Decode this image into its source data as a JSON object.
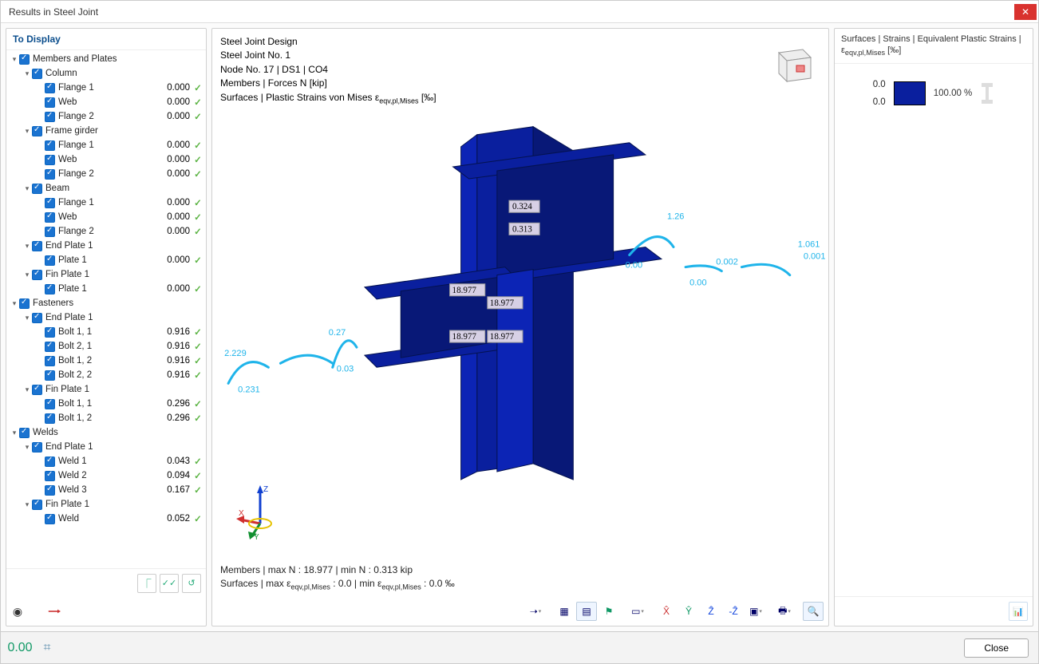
{
  "titlebar": {
    "title": "Results in Steel Joint"
  },
  "left_panel": {
    "header": "To Display"
  },
  "tree": [
    {
      "lvl": 0,
      "caret": "down",
      "cb": true,
      "label": "Members and Plates"
    },
    {
      "lvl": 1,
      "caret": "down",
      "cb": true,
      "label": "Column"
    },
    {
      "lvl": 2,
      "caret": "",
      "cb": true,
      "label": "Flange 1",
      "val": "0.000",
      "ok": true
    },
    {
      "lvl": 2,
      "caret": "",
      "cb": true,
      "label": "Web",
      "val": "0.000",
      "ok": true
    },
    {
      "lvl": 2,
      "caret": "",
      "cb": true,
      "label": "Flange 2",
      "val": "0.000",
      "ok": true
    },
    {
      "lvl": 1,
      "caret": "down",
      "cb": true,
      "label": "Frame girder"
    },
    {
      "lvl": 2,
      "caret": "",
      "cb": true,
      "label": "Flange 1",
      "val": "0.000",
      "ok": true
    },
    {
      "lvl": 2,
      "caret": "",
      "cb": true,
      "label": "Web",
      "val": "0.000",
      "ok": true
    },
    {
      "lvl": 2,
      "caret": "",
      "cb": true,
      "label": "Flange 2",
      "val": "0.000",
      "ok": true
    },
    {
      "lvl": 1,
      "caret": "down",
      "cb": true,
      "label": "Beam"
    },
    {
      "lvl": 2,
      "caret": "",
      "cb": true,
      "label": "Flange 1",
      "val": "0.000",
      "ok": true
    },
    {
      "lvl": 2,
      "caret": "",
      "cb": true,
      "label": "Web",
      "val": "0.000",
      "ok": true
    },
    {
      "lvl": 2,
      "caret": "",
      "cb": true,
      "label": "Flange 2",
      "val": "0.000",
      "ok": true
    },
    {
      "lvl": 1,
      "caret": "down",
      "cb": true,
      "label": "End Plate 1"
    },
    {
      "lvl": 2,
      "caret": "",
      "cb": true,
      "label": "Plate 1",
      "val": "0.000",
      "ok": true
    },
    {
      "lvl": 1,
      "caret": "down",
      "cb": true,
      "label": "Fin Plate 1"
    },
    {
      "lvl": 2,
      "caret": "",
      "cb": true,
      "label": "Plate 1",
      "val": "0.000",
      "ok": true
    },
    {
      "lvl": 0,
      "caret": "down",
      "cb": true,
      "label": "Fasteners"
    },
    {
      "lvl": 1,
      "caret": "down",
      "cb": true,
      "label": "End Plate 1"
    },
    {
      "lvl": 2,
      "caret": "",
      "cb": true,
      "label": "Bolt 1, 1",
      "val": "0.916",
      "ok": true
    },
    {
      "lvl": 2,
      "caret": "",
      "cb": true,
      "label": "Bolt 2, 1",
      "val": "0.916",
      "ok": true
    },
    {
      "lvl": 2,
      "caret": "",
      "cb": true,
      "label": "Bolt 1, 2",
      "val": "0.916",
      "ok": true
    },
    {
      "lvl": 2,
      "caret": "",
      "cb": true,
      "label": "Bolt 2, 2",
      "val": "0.916",
      "ok": true
    },
    {
      "lvl": 1,
      "caret": "down",
      "cb": true,
      "label": "Fin Plate 1"
    },
    {
      "lvl": 2,
      "caret": "",
      "cb": true,
      "label": "Bolt 1, 1",
      "val": "0.296",
      "ok": true
    },
    {
      "lvl": 2,
      "caret": "",
      "cb": true,
      "label": "Bolt 1, 2",
      "val": "0.296",
      "ok": true
    },
    {
      "lvl": 0,
      "caret": "down",
      "cb": true,
      "label": "Welds"
    },
    {
      "lvl": 1,
      "caret": "down",
      "cb": true,
      "label": "End Plate 1"
    },
    {
      "lvl": 2,
      "caret": "",
      "cb": true,
      "label": "Weld 1",
      "val": "0.043",
      "ok": true
    },
    {
      "lvl": 2,
      "caret": "",
      "cb": true,
      "label": "Weld 2",
      "val": "0.094",
      "ok": true
    },
    {
      "lvl": 2,
      "caret": "",
      "cb": true,
      "label": "Weld 3",
      "val": "0.167",
      "ok": true
    },
    {
      "lvl": 1,
      "caret": "down",
      "cb": true,
      "label": "Fin Plate 1"
    },
    {
      "lvl": 2,
      "caret": "",
      "cb": true,
      "label": "Weld",
      "val": "0.052",
      "ok": true
    }
  ],
  "viz": {
    "line1": "Steel Joint Design",
    "line2": "Steel Joint No. 1",
    "line3": "Node No. 17 | DS1 | CO4",
    "line4": "Members | Forces N [kip]",
    "line5_pre": "Surfaces | Plastic Strains von Mises ε",
    "line5_sub": "eqv,pl,Mises",
    "line5_suf": " [‰]",
    "labels_on_model": [
      "0.324",
      "0.313",
      "18.977",
      "18.977",
      "18.977",
      "18.977"
    ],
    "callouts": [
      "2.229",
      "0.27",
      "0.03",
      "0.231",
      "1.26",
      "0.00",
      "0.00",
      "0.002",
      "1.061",
      "0.001"
    ],
    "stats_line1": "Members | max N : 18.977 | min N : 0.313 kip",
    "stats_line2_pre": "Surfaces | max ε",
    "stats_line2_sub": "eqv,pl,Mises",
    "stats_line2_mid": " : 0.0 | min ε",
    "stats_line2_sub2": "eqv,pl,Mises",
    "stats_line2_suf": " : 0.0 ‰"
  },
  "right": {
    "header_line1": "Surfaces | Strains | Equivalent Plastic Strains |",
    "header_line2_pre": "ε",
    "header_line2_sub": "eqv,pl,Mises",
    "header_line2_suf": " [‰]",
    "legend": {
      "top": "0.0",
      "bottom": "0.0",
      "pct": "100.00 %"
    }
  },
  "footer": {
    "close": "Close"
  }
}
